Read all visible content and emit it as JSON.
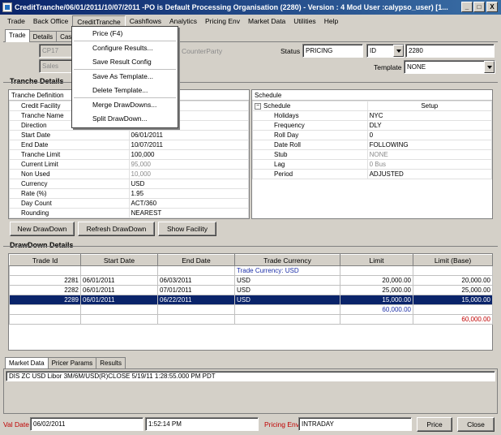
{
  "window": {
    "title": "CreditTranche/06/01/2011/10/07/2011  -PO is Default Processing Organisation  (2280) - Version : 4 Mod User :calypso_user) [1...",
    "min": "_",
    "max": "□",
    "close": "X"
  },
  "menubar": [
    "Trade",
    "Back Office",
    "CreditTranche",
    "Cashflows",
    "Analytics",
    "Pricing Env",
    "Market Data",
    "Utilities",
    "Help"
  ],
  "dropdown": {
    "groups": [
      [
        "Price (F4)"
      ],
      [
        "Configure Results...",
        "Save Result Config"
      ],
      [
        "Save As Template...",
        "Delete Template..."
      ],
      [
        "Merge DrawDowns...",
        "Split DrawDown..."
      ]
    ]
  },
  "tabs": [
    "Trade",
    "Details",
    "Cas"
  ],
  "header": {
    "cp": "CP17",
    "sales": "Sales",
    "counterparty_label": "CounterParty",
    "status_label": "Status",
    "status_value": "PRICING",
    "id_type": "ID",
    "id_value": "2280",
    "template_label": "Template",
    "template_value": "NONE"
  },
  "tranche": {
    "section_title": "Tranche Details",
    "def_title": "Tranche Definition",
    "rows": [
      {
        "label": "Credit Facility",
        "value": ""
      },
      {
        "label": "Tranche Name",
        "value": ""
      },
      {
        "label": "Direction",
        "value": ""
      },
      {
        "label": "Start Date",
        "value": "06/01/2011"
      },
      {
        "label": "End Date",
        "value": "10/07/2011"
      },
      {
        "label": "Tranche Limit",
        "value": "100,000"
      },
      {
        "label": "Current Limit",
        "value": "95,000"
      },
      {
        "label": "Non Used",
        "value": "10,000"
      },
      {
        "label": "Currency",
        "value": "USD"
      },
      {
        "label": "Rate (%)",
        "value": "1.95"
      },
      {
        "label": "Day Count",
        "value": "ACT/360"
      },
      {
        "label": "Rounding",
        "value": "NEAREST"
      }
    ]
  },
  "schedule": {
    "title": "Schedule",
    "root": "Schedule",
    "root_value": "Setup",
    "rows": [
      {
        "label": "Holidays",
        "value": "NYC"
      },
      {
        "label": "Frequency",
        "value": "DLY"
      },
      {
        "label": "Roll Day",
        "value": "0"
      },
      {
        "label": "Date Roll",
        "value": "FOLLOWING"
      },
      {
        "label": "Stub",
        "value": "NONE"
      },
      {
        "label": "Lag",
        "value": "0 Bus"
      },
      {
        "label": "Period",
        "value": "ADJUSTED"
      }
    ]
  },
  "buttons": {
    "new_drawdown": "New DrawDown",
    "refresh_drawdown": "Refresh DrawDown",
    "show_facility": "Show Facility"
  },
  "drawdown": {
    "section_title": "DrawDown Details",
    "columns": [
      "Trade Id",
      "Start Date",
      "End Date",
      "Trade Currency",
      "Limit",
      "Limit (Base)"
    ],
    "group_label": "Trade Currency: USD",
    "rows": [
      [
        "2281",
        "06/01/2011",
        "06/03/2011",
        "USD",
        "20,000.00",
        "20,000.00"
      ],
      [
        "2282",
        "06/01/2011",
        "07/01/2011",
        "USD",
        "25,000.00",
        "25,000.00"
      ],
      [
        "2289",
        "06/01/2011",
        "06/22/2011",
        "USD",
        "15,000.00",
        "15,000.00"
      ]
    ],
    "subtotal": "60,000.00",
    "total_base": "60,000.00"
  },
  "bottom_tabs": [
    "Market Data",
    "Pricer Params",
    "Results"
  ],
  "market_data_line": "DIS   ZC USD Libor 3M/6M/USD(R)CLOSE 5/19/11 1:28:55.000 PM PDT",
  "status": {
    "val_date_label": "Val Date",
    "val_date": "06/02/2011",
    "time": "1:52:14 PM",
    "pricing_env_label": "Pricing Env",
    "pricing_env": "INTRADAY",
    "price_btn": "Price",
    "close_btn": "Close"
  }
}
